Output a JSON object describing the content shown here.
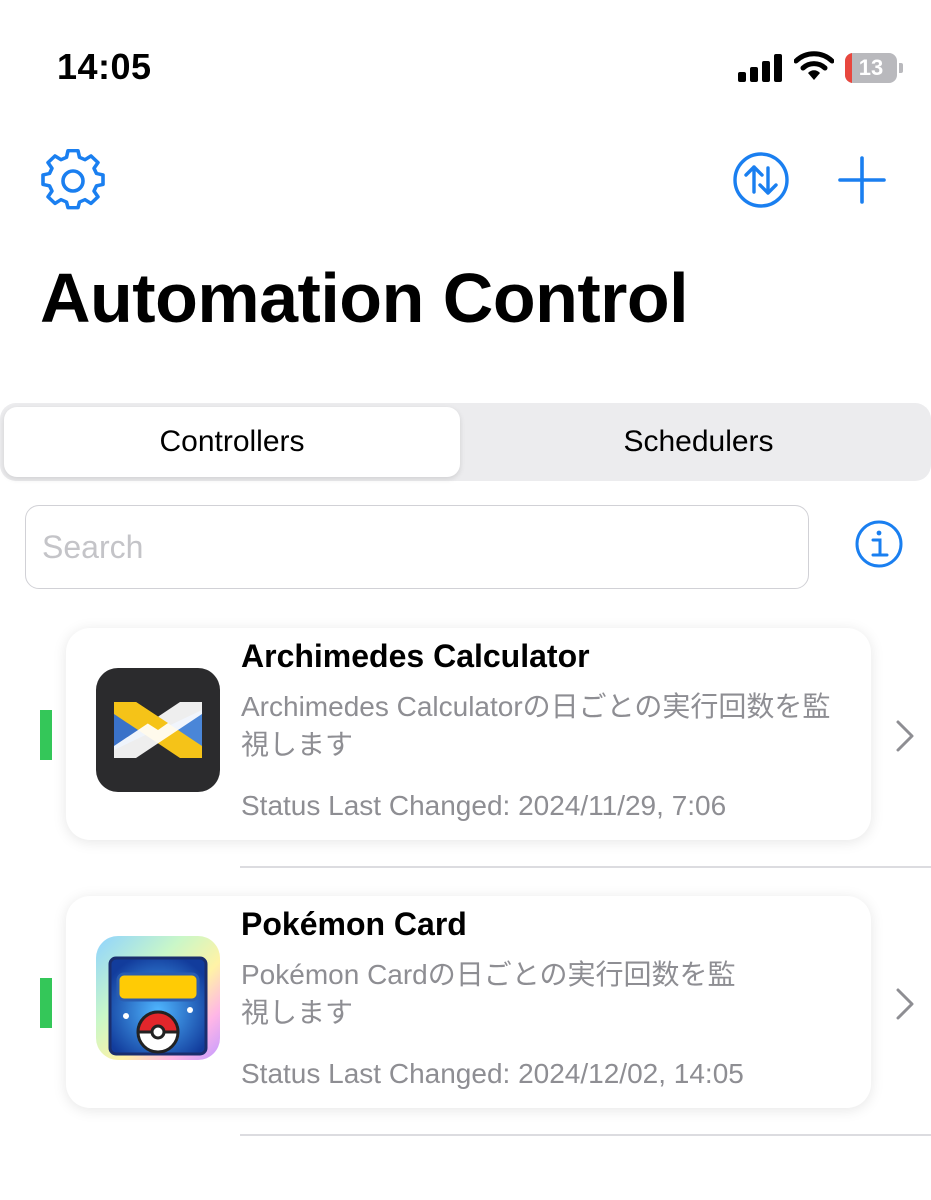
{
  "status_bar": {
    "time": "14:05",
    "battery_level": "13",
    "battery_fraction": 0.13,
    "battery_color": "#e8473e",
    "icons": [
      "cellular-signal-icon",
      "wifi-icon",
      "battery-icon"
    ]
  },
  "toolbar": {
    "left_icon": "gear-icon",
    "right_icons": [
      "arrow-up-down-circle-icon",
      "plus-icon"
    ],
    "accent_color": "#1a7ff0"
  },
  "header": {
    "title": "Automation Control"
  },
  "tabs": [
    {
      "label": "Controllers",
      "selected": true
    },
    {
      "label": "Schedulers",
      "selected": false
    }
  ],
  "search": {
    "placeholder": "Search",
    "value": "",
    "info_icon": "info-circle-icon"
  },
  "controllers": [
    {
      "title": "Archimedes Calculator",
      "description": "Archimedes Calculatorの日ごとの実行回数を監視します",
      "status": "Status Last Changed: 2024/11/29, 7:06",
      "indicator_color": "#34c759",
      "icon": "archimedes-app-icon"
    },
    {
      "title": "Pokémon Card",
      "description": "Pokémon Cardの日ごとの実行回数を監視します",
      "status": "Status Last Changed: 2024/12/02, 14:05",
      "indicator_color": "#34c759",
      "icon": "pokemon-app-icon"
    }
  ]
}
